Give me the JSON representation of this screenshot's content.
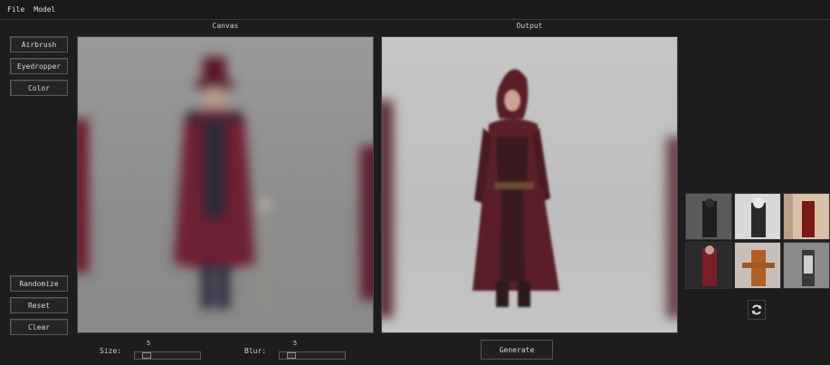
{
  "menu": {
    "file": "File",
    "model": "Model"
  },
  "panels": {
    "canvas_title": "Canvas",
    "output_title": "Output"
  },
  "tools": {
    "airbrush": "Airbrush",
    "eyedropper": "Eyedropper",
    "color": "Color"
  },
  "actions": {
    "randomize": "Randomize",
    "reset": "Reset",
    "clear": "Clear",
    "generate": "Generate"
  },
  "size": {
    "label": "Size:",
    "value": "5",
    "level": 5
  },
  "blur": {
    "label": "Blur:",
    "value": "5",
    "level": 5
  },
  "colors": {
    "background": "#1d1d1d",
    "button_border": "#5a5a5a",
    "figure_crimson": "#6e1f33"
  }
}
